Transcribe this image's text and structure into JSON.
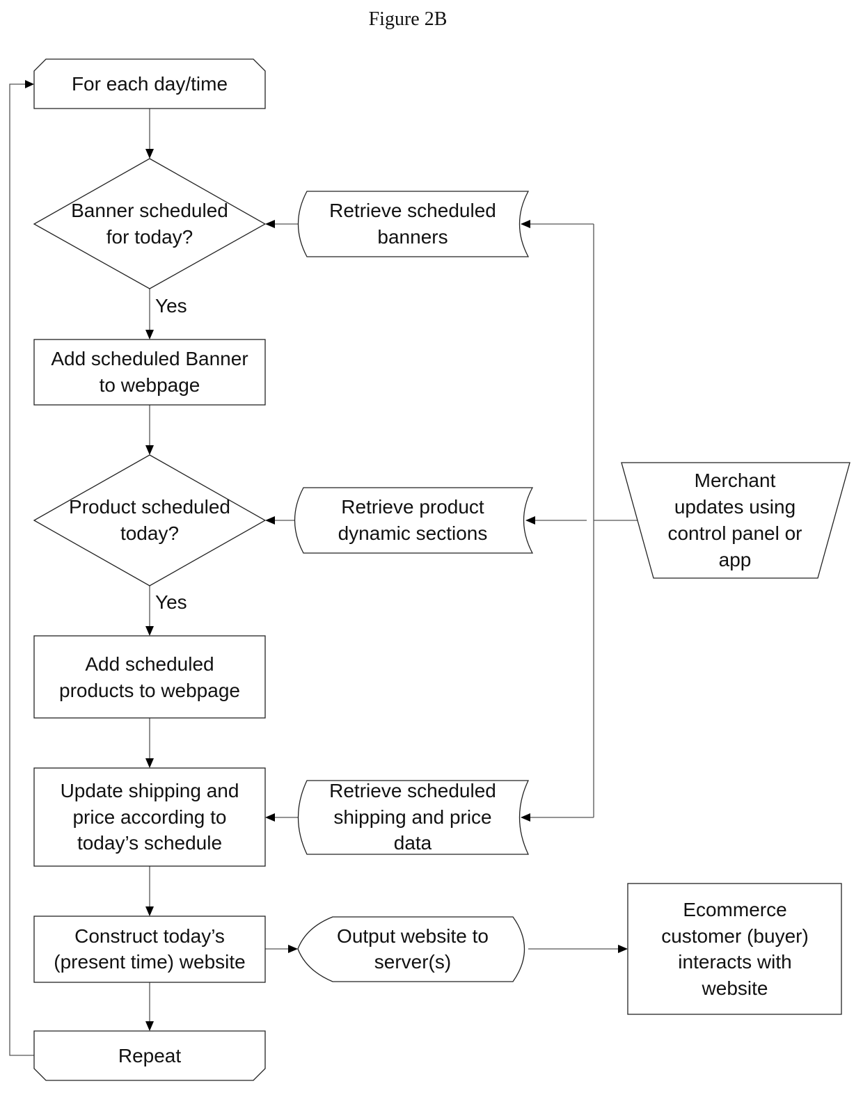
{
  "figure_title": "Figure 2B",
  "nodes": {
    "start": [
      "For each day/time"
    ],
    "banner_decision": [
      "Banner scheduled",
      "for today?"
    ],
    "retrieve_banners": [
      "Retrieve scheduled",
      "banners"
    ],
    "add_banner": [
      "Add scheduled Banner",
      "to webpage"
    ],
    "product_decision": [
      "Product scheduled",
      "today?"
    ],
    "retrieve_products": [
      "Retrieve product",
      "dynamic sections"
    ],
    "merchant": [
      "Merchant",
      "updates using",
      "control panel or",
      "app"
    ],
    "add_products": [
      "Add scheduled",
      "products to webpage"
    ],
    "update_shipping": [
      "Update shipping and",
      "price according to",
      "today’s schedule"
    ],
    "retrieve_shipping": [
      "Retrieve scheduled",
      "shipping and price",
      "data"
    ],
    "construct": [
      "Construct today’s",
      "(present time) website"
    ],
    "output": [
      "Output website to",
      "server(s)"
    ],
    "customer": [
      "Ecommerce",
      "customer (buyer)",
      "interacts with",
      "website"
    ],
    "repeat": [
      "Repeat"
    ]
  },
  "edge_labels": {
    "banner_yes": "Yes",
    "product_yes": "Yes"
  }
}
